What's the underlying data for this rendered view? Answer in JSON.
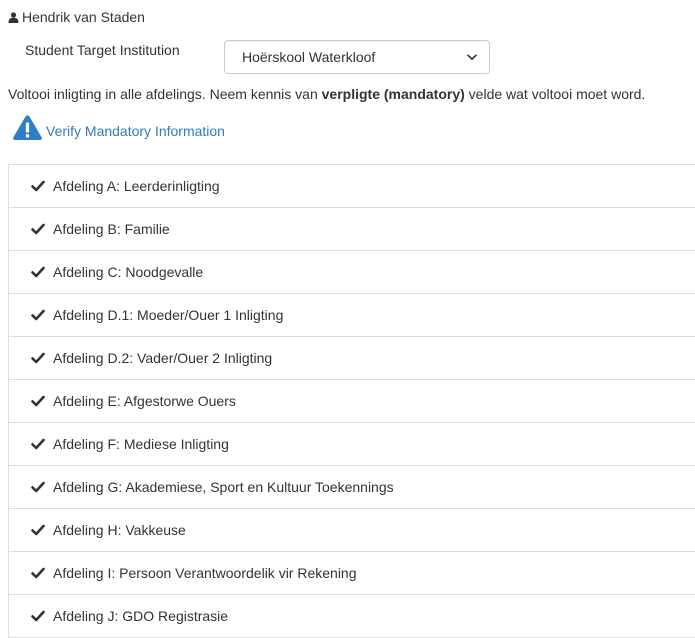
{
  "user": {
    "icon": "user-icon",
    "name": "Hendrik van Staden"
  },
  "target": {
    "label": "Student Target Institution",
    "selected": "Hoërskool Waterkloof",
    "icon": "chevron-down-icon"
  },
  "instructions": {
    "before": "Voltooi inligting in alle afdelings. Neem kennis van ",
    "bold": "verpligte (mandatory)",
    "after": " velde wat voltooi moet word."
  },
  "verify": {
    "icon": "warning-icon",
    "label": "Verify Mandatory Information",
    "color": "#337ab7",
    "icon_color": "#2f7fc6"
  },
  "sections": {
    "icon": "check-icon",
    "items": [
      {
        "label": "Afdeling A: Leerderinligting"
      },
      {
        "label": "Afdeling B: Familie"
      },
      {
        "label": "Afdeling C: Noodgevalle"
      },
      {
        "label": "Afdeling D.1: Moeder/Ouer 1 Inligting"
      },
      {
        "label": "Afdeling D.2: Vader/Ouer 2 Inligting"
      },
      {
        "label": "Afdeling E: Afgestorwe Ouers"
      },
      {
        "label": "Afdeling F: Mediese Inligting"
      },
      {
        "label": "Afdeling G: Akademiese, Sport en Kultuur Toekennings"
      },
      {
        "label": "Afdeling H: Vakkeuse"
      },
      {
        "label": "Afdeling I: Persoon Verantwoordelik vir Rekening"
      },
      {
        "label": "Afdeling J: GDO Registrasie"
      }
    ]
  }
}
